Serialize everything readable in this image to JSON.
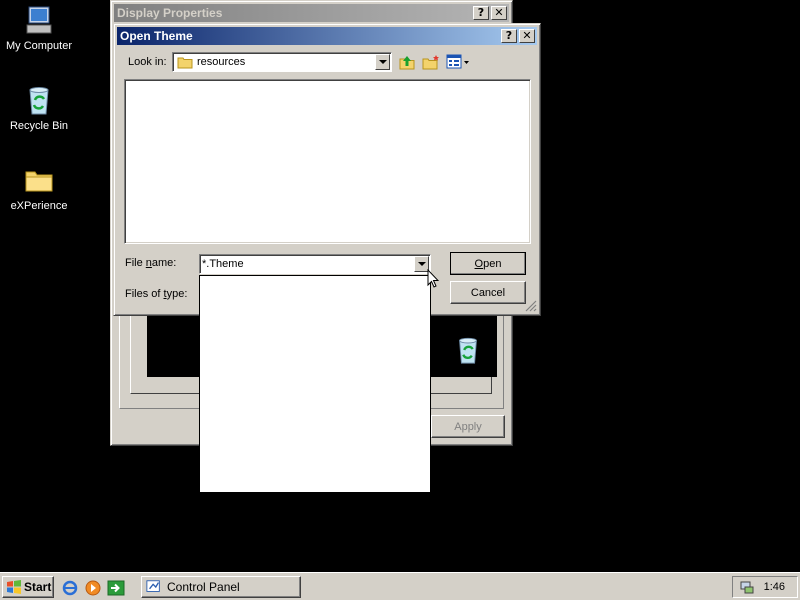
{
  "desktop": {
    "icons": [
      {
        "label": "My Computer",
        "icon": "my-computer-icon"
      },
      {
        "label": "Recycle Bin",
        "icon": "recycle-bin-icon"
      },
      {
        "label": "eXPerience",
        "icon": "folder-icon"
      }
    ]
  },
  "display_properties": {
    "title": "Display Properties",
    "apply_label": "Apply"
  },
  "open_theme": {
    "title": "Open Theme",
    "look_in_label": "Look in:",
    "look_in_value": "resources",
    "file_name_label": "File name:",
    "file_name_value": "*.Theme",
    "files_of_type_label": "Files of type:",
    "open_label": "Open",
    "cancel_label": "Cancel"
  },
  "taskbar": {
    "start_label": "Start",
    "task_label": "Control Panel",
    "clock": "1:46"
  },
  "colors": {
    "desktop": "#000000",
    "face": "#d4d0c8",
    "active_title": "#0a246a",
    "inactive_title": "#808080"
  }
}
